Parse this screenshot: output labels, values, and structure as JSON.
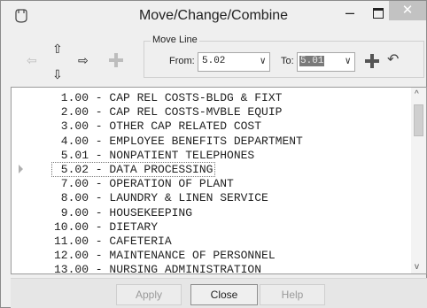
{
  "window": {
    "title": "Move/Change/Combine",
    "min_glyph": "–",
    "close_glyph": "✕"
  },
  "toolbar": {
    "up_glyph": "⇧",
    "left_glyph": "⇦",
    "right_glyph": "⇨",
    "down_glyph": "⇩",
    "undo_glyph": "↶"
  },
  "move_line": {
    "label": "Move Line",
    "from_label": "From:",
    "from_value": "5.02",
    "to_label": "To:",
    "to_value": "5.01",
    "dropdown_glyph": "∨"
  },
  "list": {
    "items": [
      {
        "text": " 1.00 - CAP REL COSTS-BLDG & FIXT"
      },
      {
        "text": " 2.00 - CAP REL COSTS-MVBLE EQUIP"
      },
      {
        "text": " 3.00 - OTHER CAP RELATED COST"
      },
      {
        "text": " 4.00 - EMPLOYEE BENEFITS DEPARTMENT"
      },
      {
        "text": " 5.01 - NONPATIENT TELEPHONES"
      },
      {
        "text": " 5.02 - DATA PROCESSING",
        "current": true
      },
      {
        "text": " 7.00 - OPERATION OF PLANT"
      },
      {
        "text": " 8.00 - LAUNDRY & LINEN SERVICE"
      },
      {
        "text": " 9.00 - HOUSEKEEPING"
      },
      {
        "text": "10.00 - DIETARY"
      },
      {
        "text": "11.00 - CAFETERIA"
      },
      {
        "text": "12.00 - MAINTENANCE OF PERSONNEL"
      },
      {
        "text": "13.00 - NURSING ADMINISTRATION"
      }
    ],
    "scroll_up": "^",
    "scroll_down": "v"
  },
  "buttons": {
    "apply": "Apply",
    "close": "Close",
    "help": "Help"
  }
}
